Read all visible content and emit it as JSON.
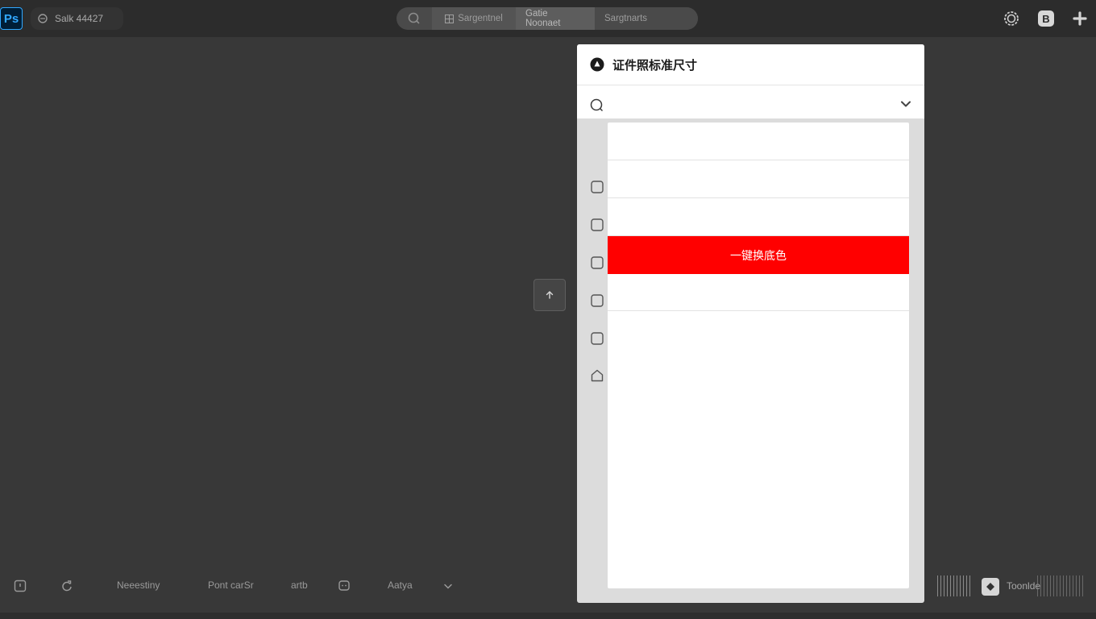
{
  "app": {
    "logo_text": "Ps",
    "document_title": "Salk  44427"
  },
  "top_tabs": [
    {
      "label": "Sargentnel"
    },
    {
      "label": "Gatie Noonaet"
    },
    {
      "label": "Sargtnarts"
    }
  ],
  "top_right": {
    "badge_label": "B"
  },
  "panel": {
    "title": "证件照标准尺寸",
    "search_value": "",
    "search_placeholder": "",
    "list_items": [
      {
        "label": ""
      },
      {
        "label": ""
      },
      {
        "label": ""
      },
      {
        "label": "一键换底色",
        "selected": true
      },
      {
        "label": ""
      }
    ],
    "accent_color": "#ff0000"
  },
  "bottom_bar": {
    "items": [
      {
        "label": "Neeestiny"
      },
      {
        "label": "Pont carSr"
      },
      {
        "label": "artb"
      },
      {
        "label": "Aatya"
      }
    ],
    "tool_label": "Toonlde"
  }
}
